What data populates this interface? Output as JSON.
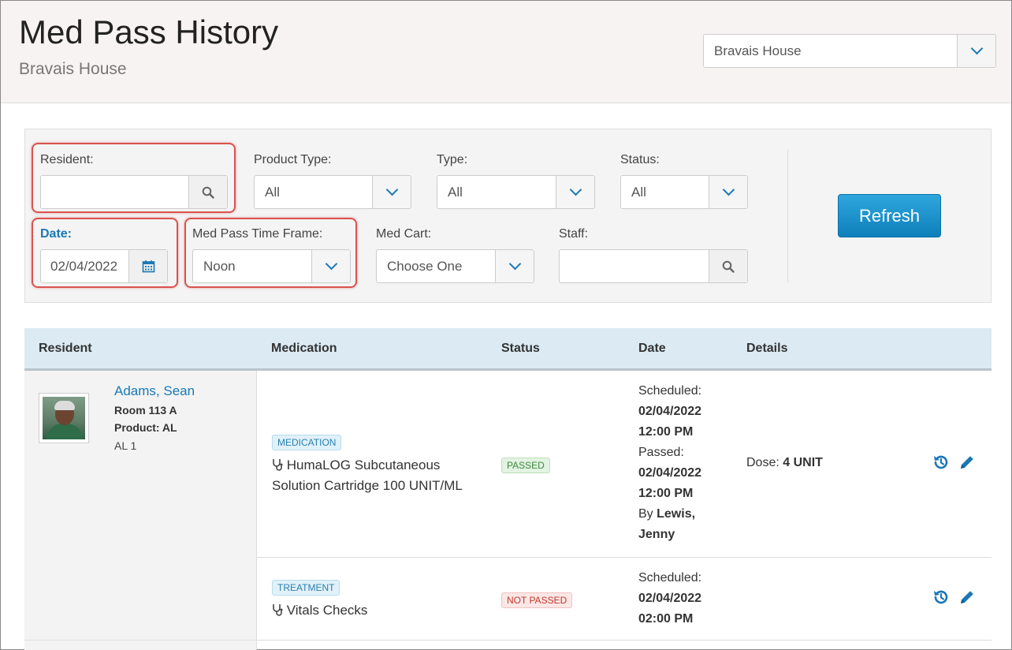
{
  "header": {
    "title": "Med Pass History",
    "subtitle": "Bravais House",
    "facility_select": "Bravais House"
  },
  "filters": {
    "resident_label": "Resident:",
    "resident_value": "",
    "product_type_label": "Product Type:",
    "product_type_value": "All",
    "type_label": "Type:",
    "type_value": "All",
    "status_label": "Status:",
    "status_value": "All",
    "date_label": "Date:",
    "date_value": "02/04/2022",
    "time_frame_label": "Med Pass Time Frame:",
    "time_frame_value": "Noon",
    "med_cart_label": "Med Cart:",
    "med_cart_value": "Choose One",
    "staff_label": "Staff:",
    "staff_value": "",
    "refresh_label": "Refresh"
  },
  "table": {
    "headers": [
      "Resident",
      "Medication",
      "Status",
      "Date",
      "Details"
    ],
    "resident": {
      "name": "Adams, Sean",
      "room": "Room 113 A",
      "product": "Product: AL",
      "level": "AL 1"
    },
    "rows": [
      {
        "category": "MEDICATION",
        "med_line1": "HumaLOG Subcutaneous",
        "med_line2": "Solution Cartridge 100 UNIT/ML",
        "status": "PASSED",
        "scheduled_label": "Scheduled:",
        "scheduled_date": "02/04/2022",
        "scheduled_time": "12:00 PM",
        "passed_label": "Passed:",
        "passed_date": "02/04/2022",
        "passed_time": "12:00 PM",
        "by_label": "By",
        "by_name_1": "Lewis,",
        "by_name_2": "Jenny",
        "dose_label": "Dose:",
        "dose_value": "4 UNIT"
      },
      {
        "category": "TREATMENT",
        "med_line1": "Vitals Checks",
        "status": "NOT PASSED",
        "scheduled_label": "Scheduled:",
        "scheduled_date": "02/04/2022",
        "scheduled_time": "02:00 PM"
      }
    ]
  },
  "colors": {
    "accent": "#1a78b4",
    "highlight": "#d9534f",
    "refresh_button": "#1a8fcc"
  },
  "icons": [
    "chevron-down-icon",
    "search-icon",
    "calendar-icon",
    "stethoscope-icon",
    "history-icon",
    "pencil-icon"
  ]
}
